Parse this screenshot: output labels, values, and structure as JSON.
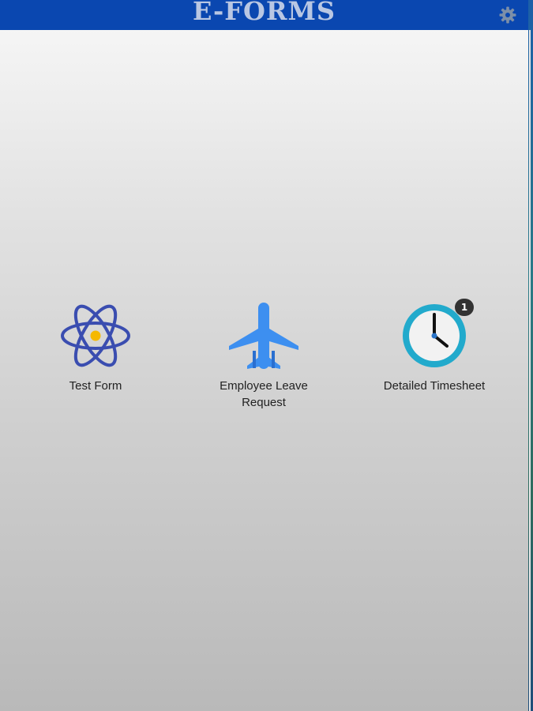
{
  "header": {
    "title": "E-FORMS",
    "settings_icon": "gear-icon"
  },
  "tiles": [
    {
      "label": "Test Form",
      "icon": "atom-icon"
    },
    {
      "label_line1": "Employee Leave",
      "label_line2": "Request",
      "icon": "airplane-icon"
    },
    {
      "label": "Detailed Timesheet",
      "icon": "clock-icon",
      "badge": "1"
    }
  ],
  "colors": {
    "header_bg": "#0a47b0",
    "title_text": "#b9c7e3",
    "atom": "#3a4db0",
    "atom_nucleus": "#f5b800",
    "plane": "#3d8ff0",
    "clock_ring": "#22aacc",
    "badge_bg": "#333333"
  }
}
